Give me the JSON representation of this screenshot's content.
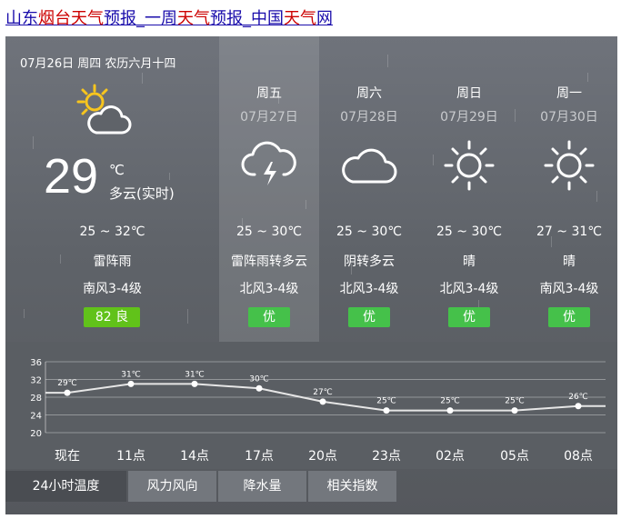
{
  "page_title": {
    "segments": [
      {
        "text": "山东",
        "color": "blue"
      },
      {
        "text": "烟台天气",
        "color": "red"
      },
      {
        "text": "预报_一周",
        "color": "blue"
      },
      {
        "text": "天气",
        "color": "red"
      },
      {
        "text": "预报_中国",
        "color": "blue"
      },
      {
        "text": "天气",
        "color": "red"
      },
      {
        "text": "网",
        "color": "blue"
      }
    ]
  },
  "today": {
    "date_line": "07月26日 周四 农历六月十四",
    "icon": "partly-cloudy-sun-icon",
    "temp": "29",
    "unit": "℃",
    "condition_now": "多云(实时)",
    "range": "25 ~ 32℃",
    "condition": "雷阵雨",
    "wind": "南风3-4级",
    "aqi": "82  良",
    "aqi_color": "#61c21a"
  },
  "forecast": [
    {
      "weekday": "周五",
      "date": "07月27日",
      "icon": "thunderstorm-icon",
      "range": "25 ~ 30℃",
      "condition": "雷阵雨转多云",
      "wind": "北风3-4级",
      "quality": "优"
    },
    {
      "weekday": "周六",
      "date": "07月28日",
      "icon": "cloud-icon",
      "range": "25 ~ 30℃",
      "condition": "阴转多云",
      "wind": "北风3-4级",
      "quality": "优"
    },
    {
      "weekday": "周日",
      "date": "07月29日",
      "icon": "sun-icon",
      "range": "25 ~ 30℃",
      "condition": "晴",
      "wind": "北风3-4级",
      "quality": "优"
    },
    {
      "weekday": "周一",
      "date": "07月30日",
      "icon": "sun-icon",
      "range": "27 ~ 31℃",
      "condition": "晴",
      "wind": "南风3-4级",
      "quality": "优"
    }
  ],
  "quality_color": "#45c14a",
  "chart_data": {
    "type": "line",
    "categories": [
      "现在",
      "11点",
      "14点",
      "17点",
      "20点",
      "23点",
      "02点",
      "05点",
      "08点"
    ],
    "values": [
      29,
      31,
      31,
      30,
      27,
      25,
      25,
      25,
      26
    ],
    "labels": [
      "29℃",
      "31℃",
      "31℃",
      "30℃",
      "27℃",
      "25℃",
      "25℃",
      "25℃",
      "26℃"
    ],
    "yticks": [
      36,
      32,
      28,
      24,
      20
    ],
    "ylim": [
      20,
      36
    ],
    "grid": true
  },
  "tabs": [
    {
      "label": "24小时温度",
      "active": true
    },
    {
      "label": "风力风向",
      "active": false
    },
    {
      "label": "降水量",
      "active": false
    },
    {
      "label": "相关指数",
      "active": false
    }
  ]
}
